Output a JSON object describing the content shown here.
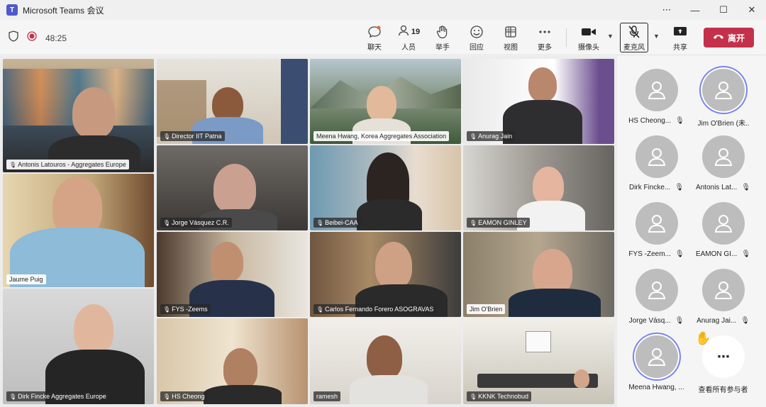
{
  "window": {
    "title": "Microsoft Teams 会议",
    "app_icon_letter": "T",
    "controls": [
      "⋯",
      "—",
      "☐",
      "✕"
    ]
  },
  "toolbar": {
    "timer": "48:25",
    "chat_label": "聊天",
    "people_label": "人员",
    "people_count": "19",
    "raise_label": "举手",
    "react_label": "回应",
    "view_label": "视图",
    "more_label": "更多",
    "camera_label": "摄像头",
    "mic_label": "麦克风",
    "share_label": "共享",
    "leave_label": "离开"
  },
  "tiles": [
    {
      "name": "Antonis Latouros - Aggregates Europe"
    },
    {
      "name": "Director IIT Patna"
    },
    {
      "name": "Meena Hwang, Korea Aggregates Association"
    },
    {
      "name": "Anurag Jain"
    },
    {
      "name": "Jaume Puig"
    },
    {
      "name": "Jorge  Vásquez  C.R."
    },
    {
      "name": "Beibei-CAA"
    },
    {
      "name": "EAMON GINLEY"
    },
    {
      "name": "FYS -Zeems"
    },
    {
      "name": "Carlos Fernando Forero ASOGRAVAS"
    },
    {
      "name": "Jim O'Brien"
    },
    {
      "name": "Dirk Fincke Aggregates Europe"
    },
    {
      "name": "HS Cheong"
    },
    {
      "name": "ramesh"
    },
    {
      "name": "KKNK Technobud"
    }
  ],
  "roster": [
    {
      "name": "HS Cheong..."
    },
    {
      "name": "Jim O'Brien (未..."
    },
    {
      "name": "Dirk Fincke..."
    },
    {
      "name": "Antonis Lat..."
    },
    {
      "name": "FYS -Zeem..."
    },
    {
      "name": "EAMON GI..."
    },
    {
      "name": "Jorge Vásq..."
    },
    {
      "name": "Anurag Jai..."
    },
    {
      "name": "Meena Hwang, ..."
    },
    {
      "name": "查看所有参与者"
    }
  ],
  "colors": {
    "accent": "#7b83eb",
    "leave": "#c4314b",
    "avatar_bg": "#bdbdbd"
  }
}
